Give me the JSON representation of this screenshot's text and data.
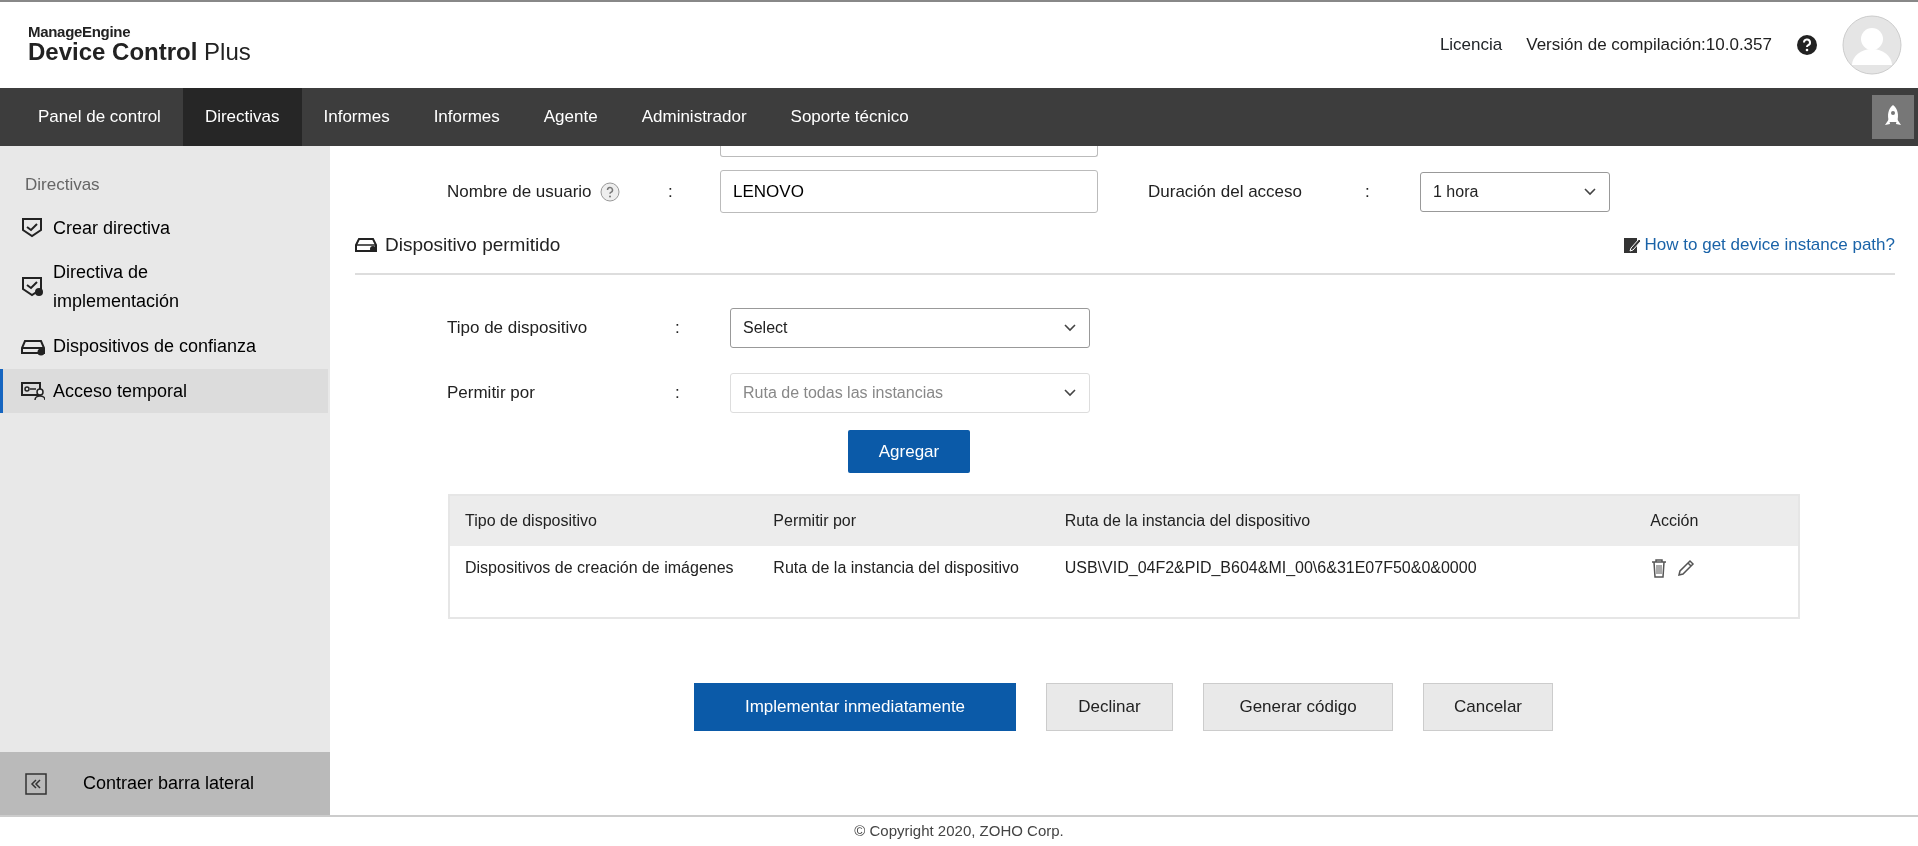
{
  "header": {
    "brand": "ManageEngine",
    "product": "**Device Control** Plus",
    "links": [
      "Licencia"
    ],
    "build": "Versión de compilación:10.0.357"
  },
  "nav": {
    "tabs": [
      {
        "label": "Panel de control",
        "selected": false
      },
      {
        "label": "Directivas",
        "selected": true
      },
      {
        "label": "Informes",
        "selected": false
      },
      {
        "label": "Informes",
        "selected": false
      },
      {
        "label": "Agente",
        "selected": false
      },
      {
        "label": "Administrador",
        "selected": false
      },
      {
        "label": "Soporte técnico",
        "selected": false
      }
    ]
  },
  "sidebar": {
    "heading": "Directivas",
    "items": [
      {
        "label": "Crear directiva",
        "selected": false
      },
      {
        "label": "Directiva de implementación",
        "selected": false
      },
      {
        "label": "Dispositivos de confianza",
        "selected": false
      },
      {
        "label": "Acceso temporal",
        "selected": true
      }
    ],
    "collapse": "Contraer barra lateral"
  },
  "form": {
    "username": {
      "label": "Nombre de usuario",
      "separator": ":",
      "value": "LENOVO"
    },
    "duration": {
      "label": "Duración del acceso",
      "separator": ":",
      "value": "1 hora"
    },
    "section": {
      "title": "Dispositivo permitido",
      "help_link": "How to get device instance path?"
    },
    "device_type": {
      "label": "Tipo de dispositivo",
      "separator": ":",
      "value": "Select",
      "disabled": false
    },
    "allow_by": {
      "label": "Permitir por",
      "separator": ":",
      "value": "Ruta de todas las instancias",
      "disabled": true
    },
    "add_button": "Agregar"
  },
  "table": {
    "columns": [
      "Tipo de dispositivo",
      "Permitir por",
      "Ruta de la instancia del dispositivo",
      "Acción"
    ],
    "rows": [
      {
        "cells": [
          "Dispositivos de creación de imágenes",
          "Ruta de la instancia del dispositivo",
          "USB\\VID_04F2&PID_B604&MI_00\\6&31E07F50&0&0000"
        ]
      }
    ]
  },
  "buttons": [
    {
      "label": "Implementar inmediatamente",
      "kind": "primary"
    },
    {
      "label": "Declinar",
      "kind": "secondary"
    },
    {
      "label": "Generar código",
      "kind": "secondary"
    },
    {
      "label": "Cancelar",
      "kind": "secondary"
    }
  ],
  "footer": "© Copyright 2020, ZOHO Corp."
}
